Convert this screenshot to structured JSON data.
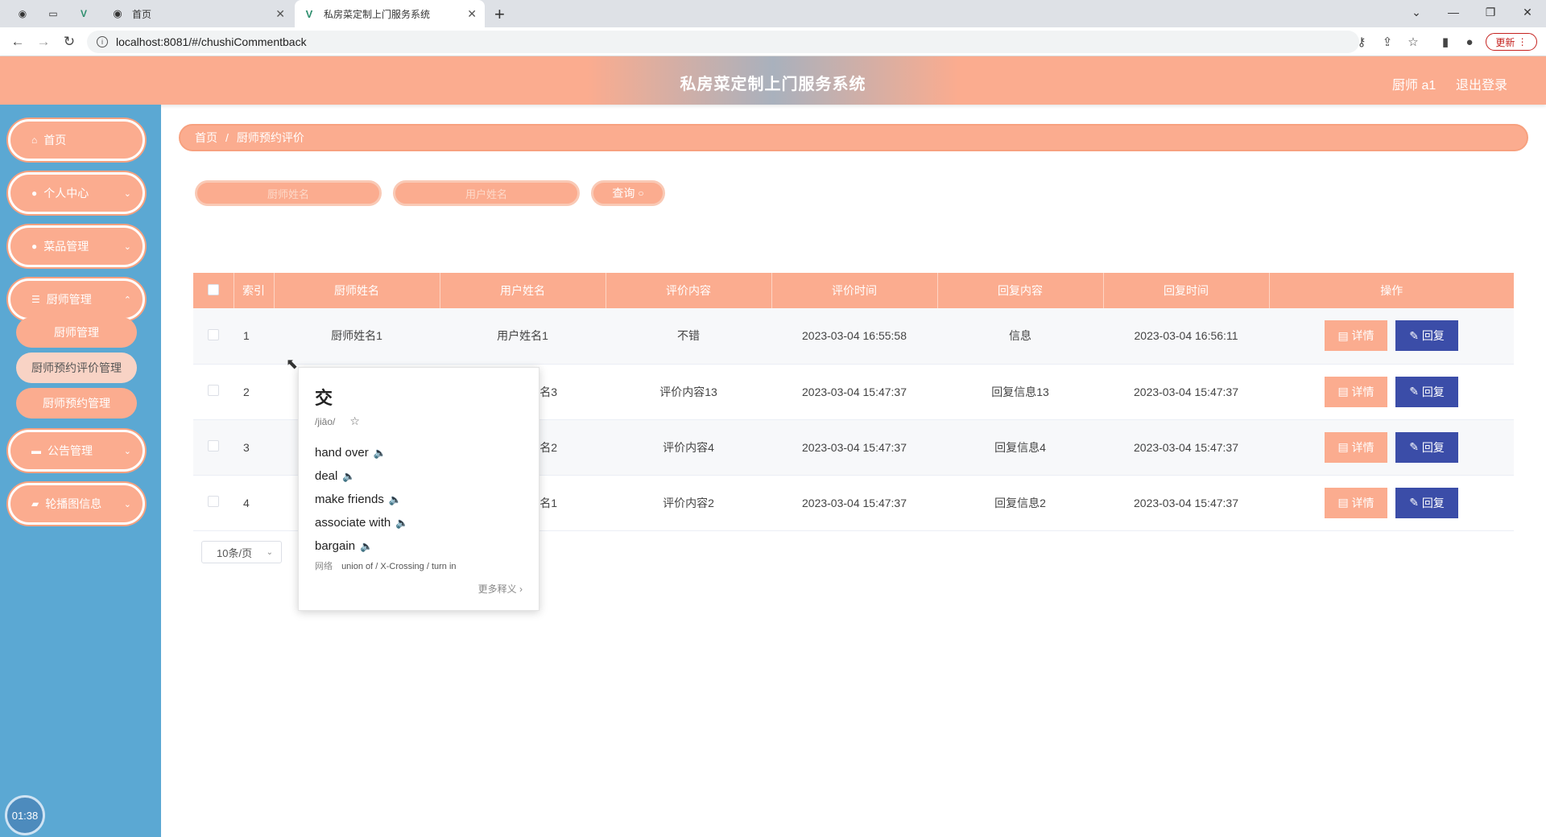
{
  "browser": {
    "tabs": [
      {
        "label": "首页",
        "active": false
      },
      {
        "label": "私房菜定制上门服务系统",
        "active": true
      }
    ],
    "url": "localhost:8081/#/chushiCommentback",
    "update_label": "更新"
  },
  "header": {
    "title": "私房菜定制上门服务系统",
    "user": "厨师 a1",
    "logout": "退出登录"
  },
  "sidebar": {
    "menus": [
      {
        "label": "首页",
        "icon": "home-icon"
      },
      {
        "label": "个人中心",
        "icon": "user-icon"
      },
      {
        "label": "菜品管理",
        "icon": "user-icon"
      },
      {
        "label": "厨师管理",
        "icon": "list-icon"
      },
      {
        "label": "公告管理",
        "icon": "monitor-icon"
      },
      {
        "label": "轮播图信息",
        "icon": "ticket-icon"
      }
    ],
    "submenus": [
      {
        "label": "厨师管理",
        "active": false
      },
      {
        "label": "厨师预约评价管理",
        "active": true
      },
      {
        "label": "厨师预约管理",
        "active": false
      }
    ],
    "timer": "01:38"
  },
  "breadcrumb": {
    "home": "首页",
    "sep": "/",
    "current": "厨师预约评价"
  },
  "search": {
    "field1_placeholder": "厨师姓名",
    "field2_placeholder": "用户姓名",
    "query_label": "查询"
  },
  "table": {
    "headers": [
      "索引",
      "厨师姓名",
      "用户姓名",
      "评价内容",
      "评价时间",
      "回复内容",
      "回复时间",
      "操作"
    ],
    "rows": [
      {
        "index": "1",
        "chef": "厨师姓名1",
        "user": "用户姓名1",
        "content": "不错",
        "time": "2023-03-04 16:55:58",
        "reply": "信息",
        "reply_time": "2023-03-04 16:56:11"
      },
      {
        "index": "2",
        "chef": "",
        "user": "名3",
        "content": "评价内容13",
        "time": "2023-03-04 15:47:37",
        "reply": "回复信息13",
        "reply_time": "2023-03-04 15:47:37"
      },
      {
        "index": "3",
        "chef": "",
        "user": "名2",
        "content": "评价内容4",
        "time": "2023-03-04 15:47:37",
        "reply": "回复信息4",
        "reply_time": "2023-03-04 15:47:37"
      },
      {
        "index": "4",
        "chef": "",
        "user": "名1",
        "content": "评价内容2",
        "time": "2023-03-04 15:47:37",
        "reply": "回复信息2",
        "reply_time": "2023-03-04 15:47:37"
      }
    ],
    "detail_label": "详情",
    "reply_label": "回复"
  },
  "pagination": {
    "page_size": "10条/页"
  },
  "dictionary": {
    "word": "交",
    "pronunciation": "/jiāo/",
    "definitions": [
      "hand over",
      "deal",
      "make friends",
      "associate with",
      "bargain"
    ],
    "web_tag": "网络",
    "web_defs": "union of / X-Crossing / turn in",
    "more": "更多释义"
  },
  "colors": {
    "primary": "#fbac8f",
    "sidebar": "#5ba8d3",
    "reply_button": "#3b4da8"
  }
}
